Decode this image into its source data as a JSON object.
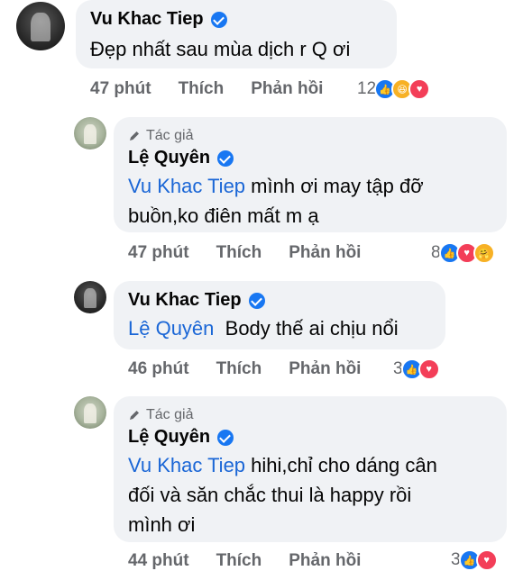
{
  "comments": [
    {
      "author": "Vu Khac Tiep",
      "author_tag": "",
      "mention": "",
      "text": "Đẹp nhất sau mùa dịch r Q ơi",
      "time": "47 phút",
      "like": "Thích",
      "reply": "Phản hồi",
      "reaction_count": "12",
      "reactions": [
        "like-icon",
        "haha-icon",
        "love-icon"
      ]
    },
    {
      "author": "Lệ Quyên",
      "author_tag": "Tác giả",
      "mention": "Vu Khac Tiep",
      "text_line1": "mình ơi may tập đỡ",
      "text_line2": "buồn,ko điên mất m ạ",
      "time": "47 phút",
      "like": "Thích",
      "reply": "Phản hồi",
      "reaction_count": "8",
      "reactions": [
        "like-icon",
        "love-icon",
        "care-icon"
      ]
    },
    {
      "author": "Vu Khac Tiep",
      "author_tag": "",
      "mention": "Lệ Quyên",
      "text": "Body thế ai chịu nổi",
      "time": "46 phút",
      "like": "Thích",
      "reply": "Phản hồi",
      "reaction_count": "3",
      "reactions": [
        "like-icon",
        "love-icon"
      ]
    },
    {
      "author": "Lệ Quyên",
      "author_tag": "Tác giả",
      "mention": "Vu Khac Tiep",
      "text_line1": "hihi,chỉ cho dáng cân",
      "text_line2": "đối và săn chắc thui là happy rồi",
      "text_line3": "mình ơi",
      "time": "44 phút",
      "like": "Thích",
      "reply": "Phản hồi",
      "reaction_count": "3",
      "reactions": [
        "like-icon",
        "love-icon"
      ]
    }
  ],
  "colors": {
    "bubble": "#f0f2f5",
    "mention": "#1a66d6",
    "verified": "#1877f2",
    "meta": "#65676b"
  }
}
